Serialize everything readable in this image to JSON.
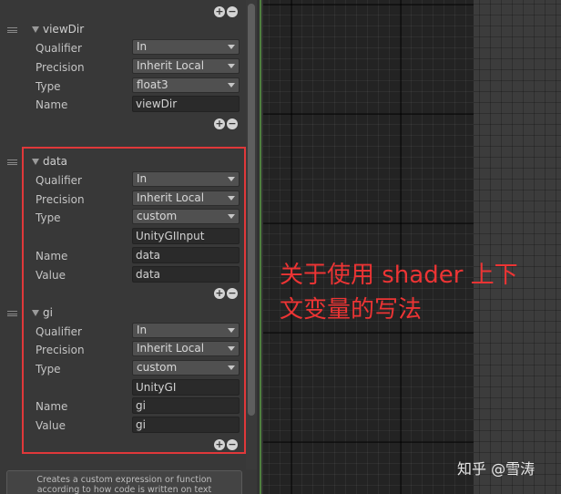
{
  "groups": [
    {
      "title": "viewDir",
      "fields": [
        {
          "label": "Qualifier",
          "kind": "dropdown",
          "value": "In"
        },
        {
          "label": "Precision",
          "kind": "dropdown",
          "value": "Inherit Local"
        },
        {
          "label": "Type",
          "kind": "dropdown",
          "value": "float3"
        },
        {
          "label": "Name",
          "kind": "text",
          "value": "viewDir"
        }
      ]
    },
    {
      "title": "data",
      "fields": [
        {
          "label": "Qualifier",
          "kind": "dropdown",
          "value": "In"
        },
        {
          "label": "Precision",
          "kind": "dropdown",
          "value": "Inherit Local"
        },
        {
          "label": "Type",
          "kind": "dropdown",
          "value": "custom"
        },
        {
          "label": "",
          "kind": "text",
          "value": "UnityGIInput"
        },
        {
          "label": "Name",
          "kind": "text",
          "value": "data"
        },
        {
          "label": "Value",
          "kind": "text",
          "value": "data"
        }
      ]
    },
    {
      "title": "gi",
      "fields": [
        {
          "label": "Qualifier",
          "kind": "dropdown",
          "value": "In"
        },
        {
          "label": "Precision",
          "kind": "dropdown",
          "value": "Inherit Local"
        },
        {
          "label": "Type",
          "kind": "dropdown",
          "value": "custom"
        },
        {
          "label": "",
          "kind": "text",
          "value": "UnityGI"
        },
        {
          "label": "Name",
          "kind": "text",
          "value": "gi"
        },
        {
          "label": "Value",
          "kind": "text",
          "value": "gi"
        }
      ]
    }
  ],
  "footer": {
    "line1": "Creates a custom expression or function",
    "line2": "according to how code is written on text"
  },
  "annotation": {
    "line1": "关于使用 shader 上下",
    "line2": "文变量的写法"
  },
  "watermark": "知乎 @雪涛",
  "colors": {
    "highlight_border": "#e0383a",
    "annotation_text": "#ec3434",
    "divider_accent": "#4f7f3f"
  },
  "icons": [
    "add-icon",
    "remove-icon",
    "drag-handle-icon",
    "foldout-arrow-icon",
    "dropdown-caret-icon"
  ]
}
